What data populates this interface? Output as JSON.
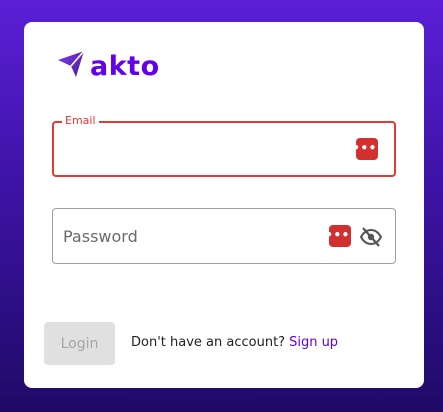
{
  "brand": {
    "name": "akto",
    "color": "#6200ea"
  },
  "form": {
    "email": {
      "label": "Email",
      "value": "",
      "error_color": "#e53935"
    },
    "password": {
      "placeholder": "Password",
      "value": ""
    },
    "password_manager_icon": "password-manager-icon",
    "visibility_icon": "eye-off-icon",
    "login_label": "Login",
    "login_disabled": true
  },
  "footer": {
    "prompt": "Don't have an account?",
    "signup_label": "Sign up"
  }
}
